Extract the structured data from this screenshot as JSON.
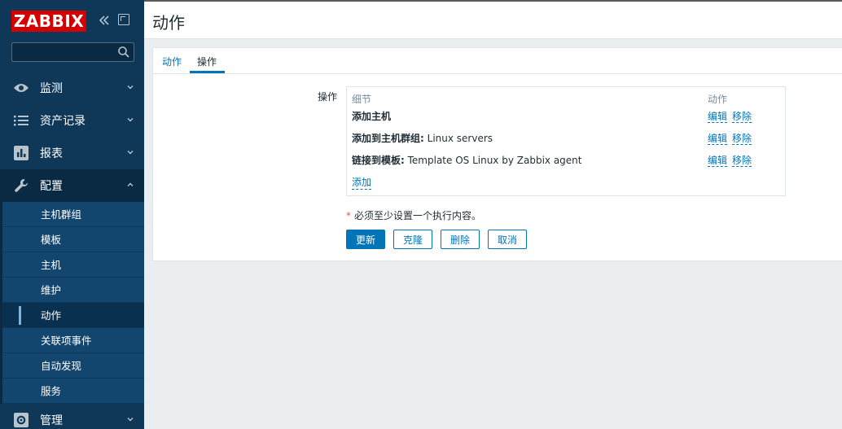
{
  "brand": {
    "logo_text": "ZABBIX",
    "logo_color": "#d40000"
  },
  "sidebar": {
    "search": {
      "placeholder": "",
      "value": ""
    },
    "menu": [
      {
        "label": "监测",
        "icon": "eye-icon"
      },
      {
        "label": "资产记录",
        "icon": "list-icon"
      },
      {
        "label": "报表",
        "icon": "bar-chart-icon"
      },
      {
        "label": "配置",
        "icon": "wrench-icon",
        "expanded": true
      },
      {
        "label": "管理",
        "icon": "gear-icon"
      }
    ],
    "config_items": [
      "主机群组",
      "模板",
      "主机",
      "维护",
      "动作",
      "关联项事件",
      "自动发现",
      "服务"
    ],
    "active_item": "动作"
  },
  "header": {
    "title": "动作"
  },
  "tabs": [
    {
      "label": "动作"
    },
    {
      "label": "操作",
      "active": true
    }
  ],
  "operations": {
    "field_label": "操作",
    "col_detail": "细节",
    "col_action": "动作",
    "rows": [
      {
        "bold": "添加主机",
        "rest": ""
      },
      {
        "bold": "添加到主机群组:",
        "rest": " Linux servers"
      },
      {
        "bold": "链接到模板:",
        "rest": " Template OS Linux by Zabbix agent"
      }
    ],
    "edit_label": "编辑",
    "remove_label": "移除",
    "add_label": "添加"
  },
  "hint": {
    "required_mark": "*",
    "text": "必须至少设置一个执行内容。"
  },
  "buttons": {
    "update": "更新",
    "clone": "克隆",
    "delete": "删除",
    "cancel": "取消"
  },
  "colors": {
    "sidebar_bg": "#0e3758",
    "accent": "#0275b8"
  }
}
